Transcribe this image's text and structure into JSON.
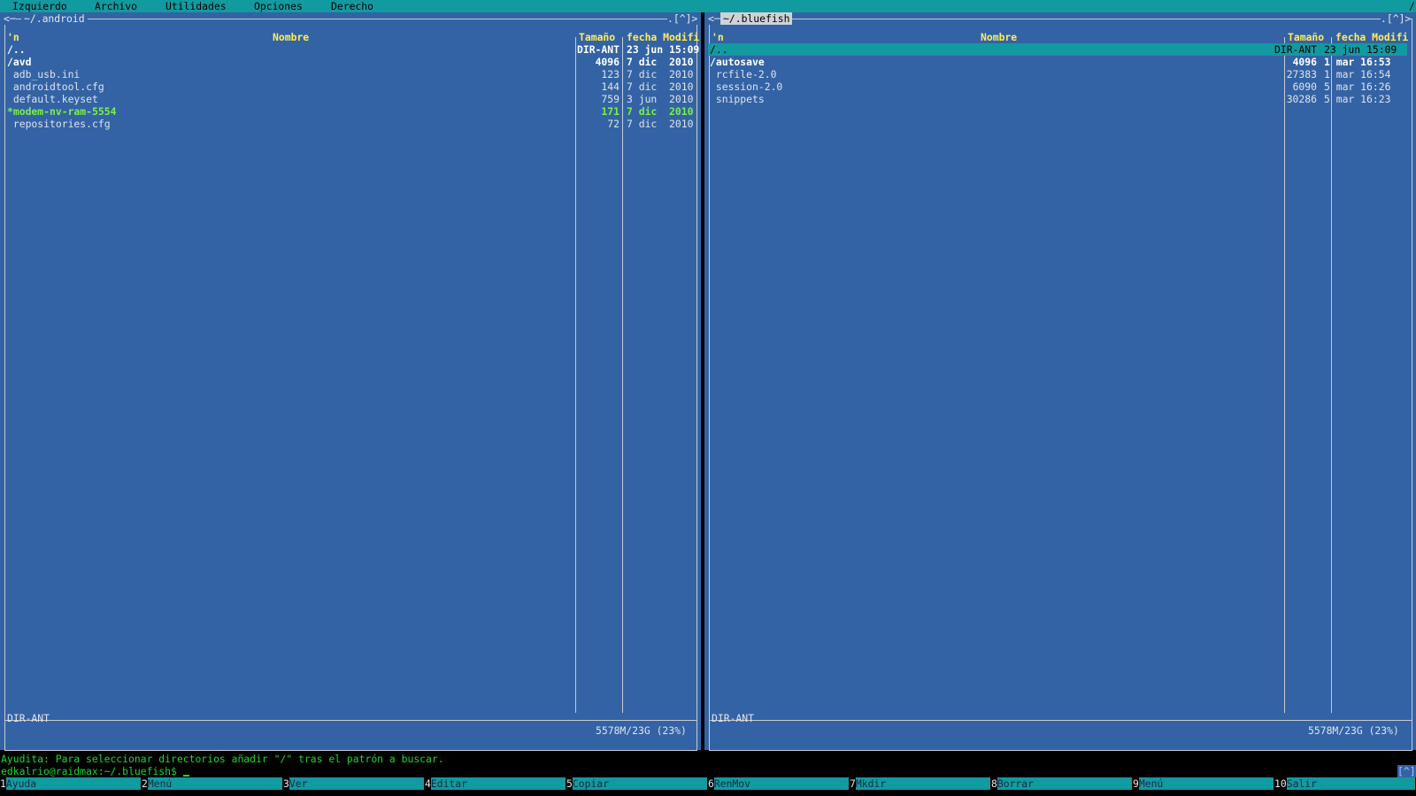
{
  "menubar": {
    "items": [
      "Izquierdo",
      "Archivo",
      "Utilidades",
      "Opciones",
      "Derecho"
    ],
    "corner": "/"
  },
  "left_panel": {
    "path": "~/.android",
    "nav_left": "<─",
    "corner_controls": ".[^]>",
    "headers": {
      "sort": "'n",
      "name": "Nombre",
      "size": "Tamaño",
      "date": "fecha Modifi"
    },
    "rows": [
      {
        "name": "/..",
        "size": "DIR-ANT",
        "date": "23 jun 15:09",
        "kind": "dir"
      },
      {
        "name": "/avd",
        "size": "4096",
        "date": "7 dic  2010",
        "kind": "dir"
      },
      {
        "name": " adb_usb.ini",
        "size": "123",
        "date": "7 dic  2010",
        "kind": "file"
      },
      {
        "name": " androidtool.cfg",
        "size": "144",
        "date": "7 dic  2010",
        "kind": "file"
      },
      {
        "name": " default.keyset",
        "size": "759",
        "date": "3 jun  2010",
        "kind": "file"
      },
      {
        "name": "*modem-nv-ram-5554",
        "size": "171",
        "date": "7 dic  2010",
        "kind": "exec"
      },
      {
        "name": " repositories.cfg",
        "size": "72",
        "date": "7 dic  2010",
        "kind": "file"
      }
    ],
    "status": "DIR-ANT",
    "disk": "5578M/23G (23%)"
  },
  "right_panel": {
    "path": "~/.bluefish",
    "nav_left": "<─",
    "corner_controls": ".[^]>",
    "headers": {
      "sort": "'n",
      "name": "Nombre",
      "size": "Tamaño",
      "date": "fecha Modifi"
    },
    "rows": [
      {
        "name": "/..",
        "size": "DIR-ANT",
        "date": "23 jun 15:09",
        "kind": "selected"
      },
      {
        "name": "/autosave",
        "size": "4096",
        "date": "1 mar 16:53",
        "kind": "dir"
      },
      {
        "name": " rcfile-2.0",
        "size": "27383",
        "date": "1 mar 16:54",
        "kind": "file"
      },
      {
        "name": " session-2.0",
        "size": "6090",
        "date": "5 mar 16:26",
        "kind": "file"
      },
      {
        "name": " snippets",
        "size": "30286",
        "date": "5 mar 16:23",
        "kind": "file"
      }
    ],
    "status": "DIR-ANT",
    "disk": "5578M/23G (23%)"
  },
  "hint": "Ayudita: Para seleccionar directorios añadir \"/\" tras el patrón a buscar.",
  "prompt": "edkalrio@raidmax:~/.bluefish$",
  "terminal_corner": "[^]",
  "fkeys": [
    {
      "num": "1",
      "label": "Ayuda"
    },
    {
      "num": "2",
      "label": "Menú"
    },
    {
      "num": "3",
      "label": "Ver"
    },
    {
      "num": "4",
      "label": "Editar"
    },
    {
      "num": "5",
      "label": "Copiar"
    },
    {
      "num": "6",
      "label": "RenMov"
    },
    {
      "num": "7",
      "label": "Mkdir"
    },
    {
      "num": "8",
      "label": "Borrar"
    },
    {
      "num": "9",
      "label": "Menú"
    },
    {
      "num": "10",
      "label": "Salir"
    }
  ]
}
